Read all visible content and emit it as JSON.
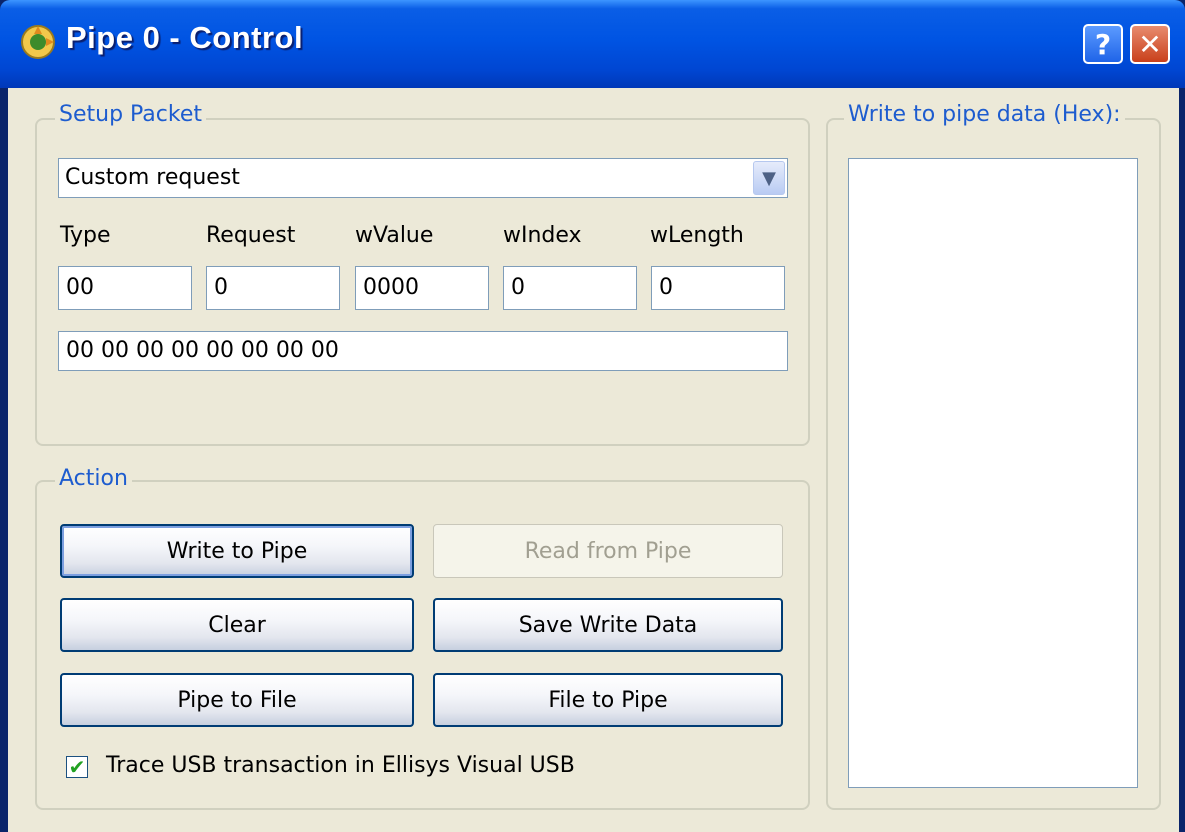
{
  "window": {
    "title": "Pipe 0 - Control",
    "help_label": "?",
    "close_label": "✕"
  },
  "setup_packet": {
    "group_label": "Setup Packet",
    "request_select": "Custom request",
    "labels": {
      "type": "Type",
      "request": "Request",
      "wvalue": "wValue",
      "windex": "wIndex",
      "wlength": "wLength"
    },
    "values": {
      "type": "00",
      "request": "0",
      "wvalue": "0000",
      "windex": "0",
      "wlength": "0"
    },
    "raw_bytes": "00 00 00 00 00 00 00 00"
  },
  "action": {
    "group_label": "Action",
    "buttons": {
      "write_to_pipe": "Write to Pipe",
      "read_from_pipe": "Read from Pipe",
      "clear": "Clear",
      "save_write_data": "Save Write Data",
      "pipe_to_file": "Pipe to File",
      "file_to_pipe": "File to Pipe"
    },
    "trace_checkbox_label": "Trace USB transaction in Ellisys Visual USB",
    "trace_checked": true
  },
  "write_data": {
    "group_label": "Write to pipe data (Hex):",
    "content": ""
  },
  "colors": {
    "titlebar": "#0054e3",
    "group_label": "#1d5ccf",
    "dialog_bg": "#ece9d8"
  }
}
